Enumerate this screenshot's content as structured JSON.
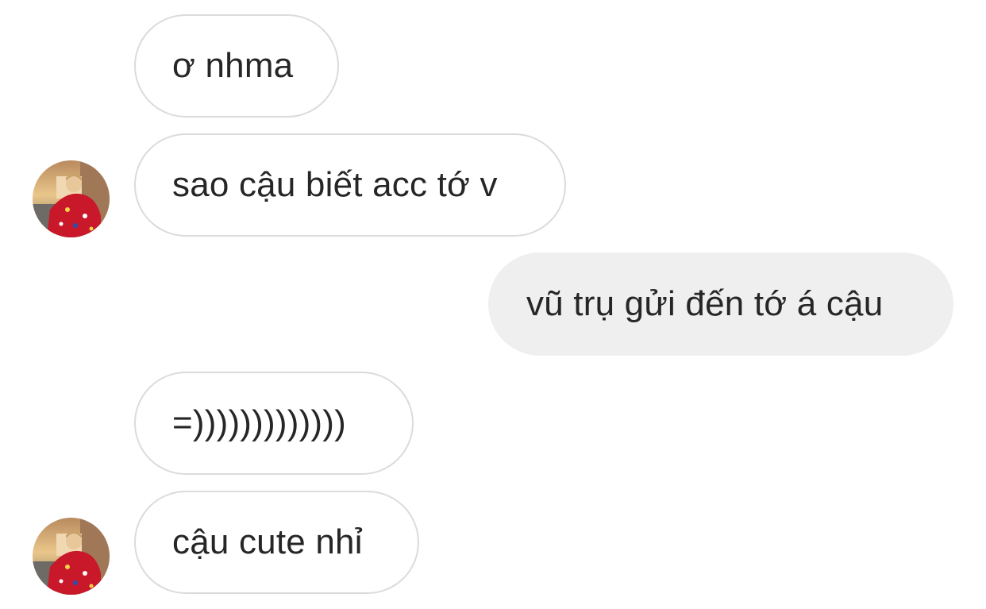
{
  "conversation": {
    "messages": [
      {
        "sender": "other",
        "text": "ơ nhma",
        "avatar_icon": ""
      },
      {
        "sender": "other",
        "text": "sao cậu biết acc tớ v",
        "avatar_icon": "user-avatar-photo"
      },
      {
        "sender": "me",
        "text": "vũ trụ gửi đến tớ á cậu"
      },
      {
        "sender": "other",
        "text": "=)))))))))))))"
      },
      {
        "sender": "other",
        "text": "cậu cute nhỉ",
        "avatar_icon": "user-avatar-photo"
      }
    ]
  },
  "colors": {
    "received_border": "#dbdbdb",
    "sent_bg": "#efefef",
    "text": "#262626",
    "background": "#ffffff"
  }
}
